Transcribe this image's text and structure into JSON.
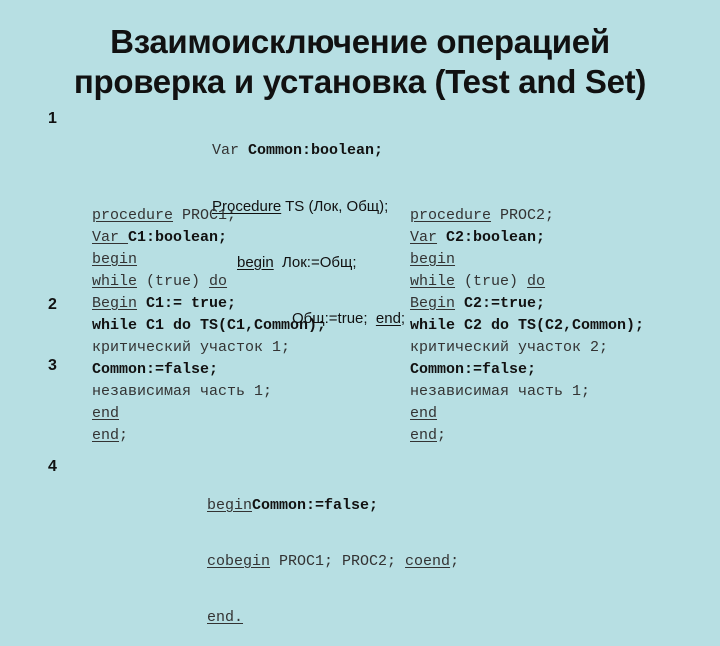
{
  "title": {
    "line1": "Взаимоисключение операцией",
    "line2": "проверка и установка (Test and Set)"
  },
  "markers": [
    "1",
    "2",
    "3",
    "4"
  ],
  "ts_block": {
    "var_kw": "Var ",
    "var_decl": "Common:boolean;",
    "proc_kw": "Procedure",
    "proc_sig": " TS (Лок, Общ);",
    "begin_kw": "begin",
    "begin_body": "  Лок:=Общ;",
    "assign": "Общ:=true;  ",
    "end_kw": "end",
    "end_semicolon": ";"
  },
  "proc1": {
    "lines": [
      {
        "kw": "procedure",
        "rest": " PROC1;"
      },
      {
        "kw": "Var ",
        "bold": "C1:boolean;"
      },
      {
        "kw": "begin"
      },
      {
        "kw": "while",
        "rest": " (true) ",
        "kw2": "do"
      },
      {
        "kw": "Begin",
        "rest": " ",
        "bold": "C1:= true;"
      },
      {
        "bold": "while C1 do TS(C1,Common);"
      },
      {
        "rest": "критический участок 1;"
      },
      {
        "bold": "Common:=false;"
      },
      {
        "rest": "независимая часть 1;"
      },
      {
        "kw": "end"
      },
      {
        "kw": "end",
        "rest": ";"
      }
    ]
  },
  "proc2": {
    "lines": [
      {
        "kw": "procedure",
        "rest": " PROC2;"
      },
      {
        "kw": "Var",
        "rest": " ",
        "bold": "C2:boolean;"
      },
      {
        "kw": "begin"
      },
      {
        "kw": "while",
        "rest": " (true) ",
        "kw2": "do"
      },
      {
        "kw": "Begin",
        "rest": " ",
        "bold": "C2:=true;"
      },
      {
        "bold": "while C2 do TS(C2,Common);"
      },
      {
        "rest": "критический участок 2;"
      },
      {
        "bold": "Common:=false;"
      },
      {
        "rest": "независимая часть 1;"
      },
      {
        "kw": "end"
      },
      {
        "kw": "end",
        "rest": ";"
      }
    ]
  },
  "main_block": {
    "begin_kw": "begin",
    "begin_stmt": "Common:=false;",
    "cobegin_kw": "cobegin",
    "cobegin_body": " PROC1; PROC2; ",
    "coend_kw": "coend",
    "coend_semicolon": ";",
    "end_kw": "end."
  }
}
